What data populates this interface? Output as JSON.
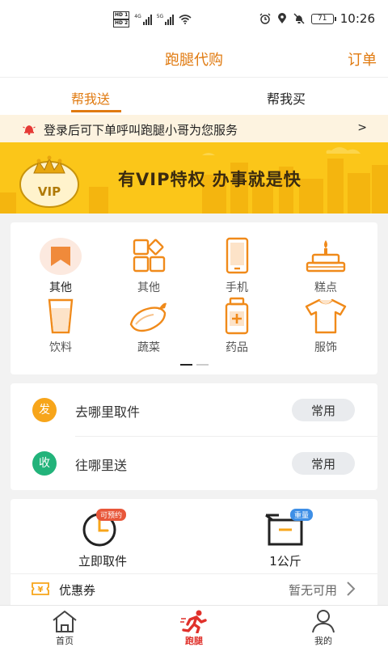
{
  "status_bar": {
    "time": "10:26",
    "battery": "71",
    "network_a": "4G",
    "network_b": "5G",
    "hd1": "HD 1",
    "hd2": "HD 2"
  },
  "header": {
    "title": "跑腿代购",
    "action": "订单"
  },
  "tabs": [
    {
      "label": "帮我送",
      "active": true
    },
    {
      "label": "帮我买",
      "active": false
    }
  ],
  "notice": {
    "text": "登录后可下单呼叫跑腿小哥为您服务",
    "arrow": ">"
  },
  "banner": {
    "badge": "VIP",
    "text": "有VIP特权  办事就是快",
    "color": "#fbc619"
  },
  "categories": [
    {
      "label": "其他",
      "icon": "flag-icon",
      "active": true
    },
    {
      "label": "其他",
      "icon": "grid-icon"
    },
    {
      "label": "手机",
      "icon": "phone-icon"
    },
    {
      "label": "糕点",
      "icon": "cake-icon"
    },
    {
      "label": "饮料",
      "icon": "cup-icon"
    },
    {
      "label": "蔬菜",
      "icon": "eggplant-icon"
    },
    {
      "label": "药品",
      "icon": "medicine-icon"
    },
    {
      "label": "服饰",
      "icon": "shirt-icon"
    }
  ],
  "page_indicator": {
    "pages": 2,
    "current": 1
  },
  "address": {
    "pickup": {
      "badge": "发",
      "label": "去哪里取件",
      "button": "常用"
    },
    "dropoff": {
      "badge": "收",
      "label": "往哪里送",
      "button": "常用"
    }
  },
  "options": {
    "time": {
      "tag": "可预约",
      "label": "立即取件"
    },
    "weight": {
      "tag": "重量",
      "label": "1公斤"
    }
  },
  "coupon": {
    "icon_text": "¥",
    "label": "优惠券",
    "status": "暂无可用"
  },
  "bottom_nav": [
    {
      "label": "首页",
      "icon": "home-icon"
    },
    {
      "label": "跑腿",
      "icon": "runner-icon",
      "active": true
    },
    {
      "label": "我的",
      "icon": "person-icon"
    }
  ],
  "colors": {
    "accent": "#e07a10",
    "nav_active": "#e0312b",
    "pickup": "#f7a51a",
    "dropoff": "#22b37a",
    "notice_bg": "#fdf3e0"
  }
}
